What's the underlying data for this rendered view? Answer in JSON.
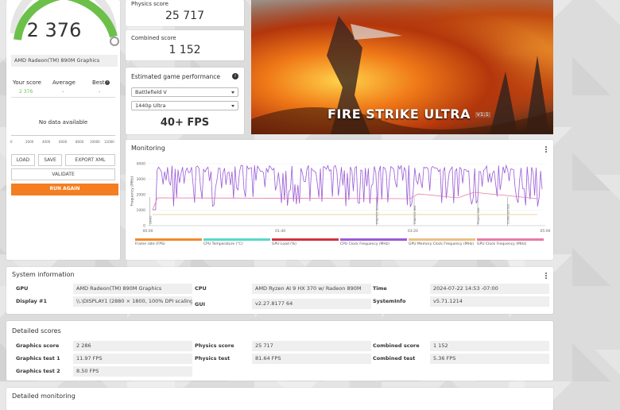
{
  "score_panel": {
    "score": "2 376",
    "gpu_name": "AMD Radeon(TM) 890M Graphics",
    "cols": [
      {
        "label": "Your score",
        "value": "2 376"
      },
      {
        "label": "Average",
        "value": "-"
      },
      {
        "label": "Best",
        "value": "-"
      }
    ],
    "best_info": "i",
    "no_data": "No data available",
    "axis_ticks": [
      "0",
      "2000",
      "4000",
      "6000",
      "8000",
      "10000",
      "12000"
    ],
    "load_label": "LOAD",
    "save_label": "SAVE",
    "export_label": "EXPORT XML",
    "validate_label": "VALIDATE",
    "run_again_label": "RUN AGAIN"
  },
  "physics": {
    "label": "Physics score",
    "value": "25 717"
  },
  "combined": {
    "label": "Combined score",
    "value": "1 152"
  },
  "game_perf": {
    "title": "Estimated game performance",
    "game": "Battlefield V",
    "resolution": "1440p Ultra",
    "fps": "40+ FPS"
  },
  "banner": {
    "title": "FIRE STRIKE ULTRA",
    "version": "v1.1"
  },
  "monitoring": {
    "title": "Monitoring",
    "y_label": "Frequency (MHz)",
    "y_ticks": [
      "4000",
      "3000",
      "2000",
      "1000",
      "0"
    ],
    "x_ticks": [
      "00:00",
      "01:40",
      "03:20",
      "05:00"
    ],
    "markers": [
      "Demo",
      "Graphics test",
      "Graphics test",
      "Physics test",
      "Combined test"
    ],
    "legend": [
      {
        "label": "Frame rate (FPS)",
        "color": "#f08a2c"
      },
      {
        "label": "CPU Temperature (°C)",
        "color": "#5ad8c6"
      },
      {
        "label": "GPU Load (%)",
        "color": "#d0343c"
      },
      {
        "label": "CPU Clock Frequency (MHz)",
        "color": "#9a5bd6"
      },
      {
        "label": "GPU Memory Clock Frequency (MHz)",
        "color": "#e8c184"
      },
      {
        "label": "GPU Clock Frequency (MHz)",
        "color": "#e87aa8"
      }
    ]
  },
  "system_info": {
    "title": "System information",
    "rows": [
      [
        {
          "label": "GPU",
          "value": "AMD Radeon(TM) 890M Graphics"
        },
        {
          "label": "CPU",
          "value": "AMD Ryzen AI 9 HX 370 w/ Radeon 890M"
        },
        {
          "label": "Time",
          "value": "2024-07-22 14:53 -07:00"
        }
      ],
      [
        {
          "label": "Display #1",
          "value": "\\\\.\\DISPLAY1 (2880 × 1800, 100% DPI scaling)"
        },
        {
          "label": "GUI",
          "value": "v2.27.8177 64"
        },
        {
          "label": "SystemInfo",
          "value": "v5.71.1214"
        }
      ]
    ]
  },
  "detailed_scores": {
    "title": "Detailed scores",
    "rows": [
      [
        {
          "label": "Graphics score",
          "value": "2 286"
        },
        {
          "label": "Physics score",
          "value": "25 717"
        },
        {
          "label": "Combined score",
          "value": "1 152"
        }
      ],
      [
        {
          "label": "Graphics test 1",
          "value": "11.97 FPS"
        },
        {
          "label": "Physics test",
          "value": "81.64 FPS"
        },
        {
          "label": "Combined test",
          "value": "5.36 FPS"
        }
      ],
      [
        {
          "label": "Graphics test 2",
          "value": "8.50 FPS"
        }
      ]
    ]
  },
  "detailed_monitoring": {
    "title": "Detailed monitoring"
  },
  "colors": {
    "accent_green": "#6cc04a",
    "run_again": "#f57e20",
    "cpu_freq": "#9a5bd6"
  }
}
